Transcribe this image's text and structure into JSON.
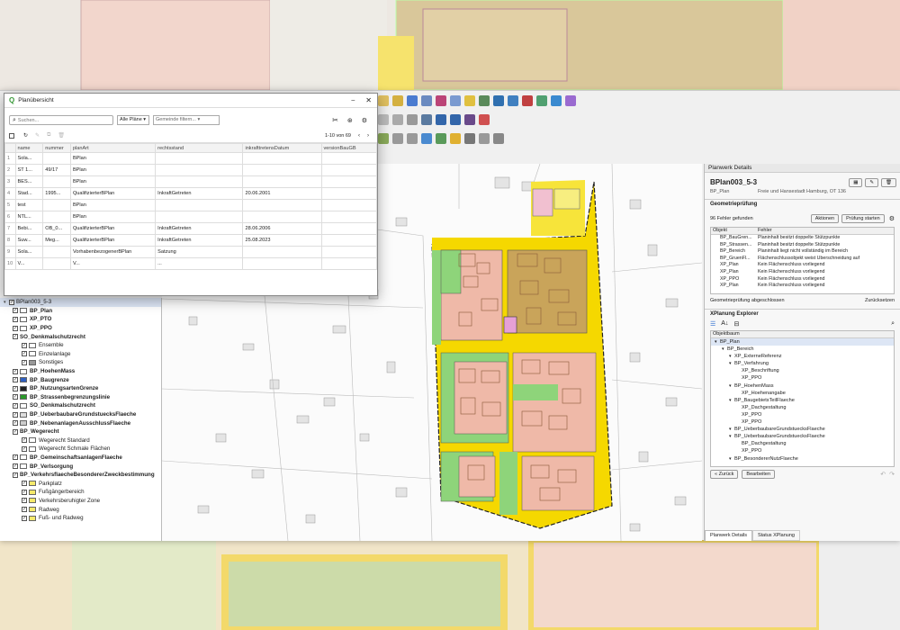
{
  "dialog": {
    "title": "Planübersicht",
    "search_placeholder": "Suchen...",
    "filter_select": "Alle Pläne",
    "filter_field": "Gemeinde filtern...",
    "pagination": "1-10 von 69",
    "columns": [
      "",
      "name",
      "nummer",
      "planArt",
      "rechtsstand",
      "inkrafttretensDatum",
      "versionBauGB"
    ],
    "rows": [
      [
        "1",
        "Sola...",
        "",
        "BPlan",
        "",
        "",
        ""
      ],
      [
        "2",
        "ST 1...",
        "49/17",
        "BPlan",
        "",
        "",
        ""
      ],
      [
        "3",
        "BES...",
        "",
        "BPlan",
        "",
        "",
        ""
      ],
      [
        "4",
        "Stad...",
        "1995...",
        "QualifizierterBPlan",
        "InkraftGetreten",
        "20.06.2001",
        ""
      ],
      [
        "5",
        "test",
        "",
        "BPlan",
        "",
        "",
        ""
      ],
      [
        "6",
        "NTL...",
        "",
        "BPlan",
        "",
        "",
        ""
      ],
      [
        "7",
        "Bebi...",
        "OB_0...",
        "QualifizierterBPlan",
        "InkraftGetreten",
        "28.06.2006",
        ""
      ],
      [
        "8",
        "Suw...",
        "Meg...",
        "QualifizierterBPlan",
        "InkraftGetreten",
        "25.08.2023",
        ""
      ],
      [
        "9",
        "Sola...",
        "",
        "VorhabenbezogenerBPlan",
        "Satzung",
        "",
        ""
      ],
      [
        "10",
        "V...",
        "",
        "V...",
        "...",
        "",
        ""
      ]
    ]
  },
  "layers": {
    "root": "BPlan003_5-3",
    "items": [
      {
        "label": "BP_Plan",
        "depth": 1,
        "color": "#ffffff",
        "bold": true
      },
      {
        "label": "XP_PTO",
        "depth": 1,
        "color": "#ffffff",
        "bold": true
      },
      {
        "label": "XP_PPO",
        "depth": 1,
        "color": "#ffffff",
        "bold": true
      },
      {
        "label": "SO_Denkmalschutzrecht",
        "depth": 1,
        "color": "",
        "bold": true
      },
      {
        "label": "Ensemble",
        "depth": 2,
        "color": "#ffffff",
        "bold": false
      },
      {
        "label": "Einzelanlage",
        "depth": 2,
        "color": "#ffffff",
        "bold": false
      },
      {
        "label": "Sonstiges",
        "depth": 2,
        "color": "#999999",
        "bold": false
      },
      {
        "label": "BP_HoehenMass",
        "depth": 1,
        "color": "#ffffff",
        "bold": true
      },
      {
        "label": "BP_Baugrenze",
        "depth": 1,
        "color": "#3060c0",
        "bold": true
      },
      {
        "label": "BP_NutzungsartenGrenze",
        "depth": 1,
        "color": "#222222",
        "bold": true
      },
      {
        "label": "BP_Strassenbegrenzungslinie",
        "depth": 1,
        "color": "#2a9a2a",
        "bold": true
      },
      {
        "label": "SO_Denkmalschutzrecht",
        "depth": 1,
        "color": "#ffffff",
        "bold": true
      },
      {
        "label": "BP_UeberbaubareGrundstuecksFlaeche",
        "depth": 1,
        "color": "#dddddd",
        "bold": true
      },
      {
        "label": "BP_NebenanlagenAusschlussFlaeche",
        "depth": 1,
        "color": "#cccccc",
        "bold": true
      },
      {
        "label": "BP_Wegerecht",
        "depth": 1,
        "color": "",
        "bold": true
      },
      {
        "label": "Wegerecht Standard",
        "depth": 2,
        "color": "#ffffff",
        "bold": false
      },
      {
        "label": "Wegerecht Schmale Flächen",
        "depth": 2,
        "color": "#ffffff",
        "bold": false
      },
      {
        "label": "BP_GemeinschaftsanlagenFlaeche",
        "depth": 1,
        "color": "#ffffff",
        "bold": true
      },
      {
        "label": "BP_Verlsorgung",
        "depth": 1,
        "color": "#ffffff",
        "bold": true
      },
      {
        "label": "BP_VerkehrsflaecheBesondererZweckbestimmung",
        "depth": 1,
        "color": "",
        "bold": true
      },
      {
        "label": "Parkplatz",
        "depth": 2,
        "color": "#f5e96b",
        "bold": false
      },
      {
        "label": "Fußgängerbereich",
        "depth": 2,
        "color": "#f5e96b",
        "bold": false
      },
      {
        "label": "Verkehrsberuhigter Zone",
        "depth": 2,
        "color": "#f5e96b",
        "bold": false
      },
      {
        "label": "Radweg",
        "depth": 2,
        "color": "#f5e96b",
        "bold": false
      },
      {
        "label": "Fuß- und Radweg",
        "depth": 2,
        "color": "#f5e96b",
        "bold": false
      }
    ]
  },
  "details": {
    "panel_title": "Planwerk Details",
    "plan_name": "BPlan003_5-3",
    "plan_type": "BP_Plan",
    "plan_gemeinde": "Freie und Hansestadt Hamburg, OT 136",
    "geom_title": "Geometrieprüfung",
    "errors_found": "96 Fehler gefunden",
    "actions_btn": "Aktionen",
    "start_btn": "Prüfung starten",
    "err_col_obj": "Objekt",
    "err_col_err": "Fehler",
    "errors": [
      [
        "BP_BauGren...",
        "Planinhalt besitzt doppelte Stützpunkte"
      ],
      [
        "BP_Strassen...",
        "Planinhalt besitzt doppelte Stützpunkte"
      ],
      [
        "BP_Bereich",
        "Planinhalt liegt nicht vollständig im Bereich"
      ],
      [
        "BP_GruenFl...",
        "Flächenschlussobjekt weist Überschneidung auf"
      ],
      [
        "XP_Plan",
        "Kein Flächenschluss vorliegend"
      ],
      [
        "XP_Plan",
        "Kein Flächenschluss vorliegend"
      ],
      [
        "XP_PPO",
        "Kein Flächenschluss vorliegend"
      ],
      [
        "XP_Plan",
        "Kein Flächenschluss vorliegend"
      ]
    ],
    "geom_done": "Geometrieprüfung abgeschlossen",
    "reset": "Zurücksetzen",
    "xplan_title": "XPlanung Explorer",
    "tree_header": "Objektbaum",
    "tree": [
      {
        "t": "BP_Plan",
        "d": 0,
        "sel": true
      },
      {
        "t": "BP_Bereich",
        "d": 1
      },
      {
        "t": "XP_ExterneReferenz",
        "d": 2
      },
      {
        "t": "BP_Verfahrung",
        "d": 2
      },
      {
        "t": "XP_Beschriftung",
        "d": 3
      },
      {
        "t": "XP_PPO",
        "d": 3
      },
      {
        "t": "BP_HoehenMass",
        "d": 2
      },
      {
        "t": "XP_Hoehenangabe",
        "d": 3
      },
      {
        "t": "BP_BaugebietsTeilFlaeche",
        "d": 2
      },
      {
        "t": "XP_Dachgestaltung",
        "d": 3
      },
      {
        "t": "XP_PPO",
        "d": 3
      },
      {
        "t": "XP_PPO",
        "d": 3
      },
      {
        "t": "BP_UeberbaubareGrundstuecksFlaeche",
        "d": 2
      },
      {
        "t": "BP_UeberbaubareGrundstuecksFlaeche",
        "d": 2
      },
      {
        "t": "BP_Dachgestaltung",
        "d": 3
      },
      {
        "t": "XP_PPO",
        "d": 3
      },
      {
        "t": "BP_BesondererNutzFlaeche",
        "d": 2
      }
    ],
    "back_btn": "« Zurück",
    "edit_btn": "Bearbeiten",
    "tab1": "Planwerk Details",
    "tab2": "Status XPlanung"
  },
  "colors": {
    "accent": "#2f6fd0",
    "road": "#f5d800",
    "green": "#8ed47a",
    "pink": "#efb9a8",
    "brown": "#c9a45a"
  }
}
